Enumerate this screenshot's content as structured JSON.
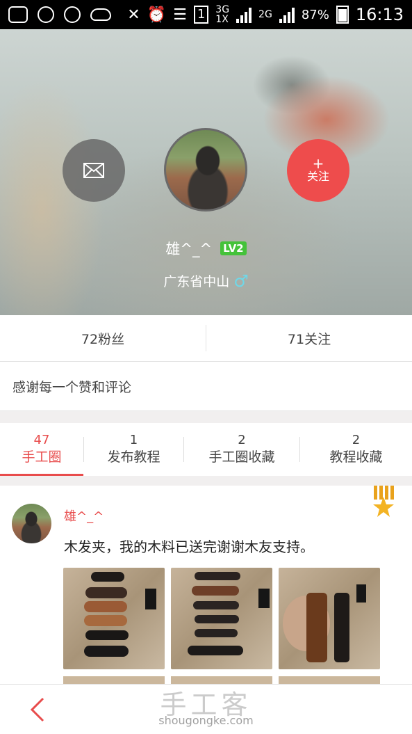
{
  "status_bar": {
    "lte_top": "3G",
    "lte_bottom": "1X",
    "network": "2G",
    "sim": "1",
    "battery": "87%",
    "time": "16:13"
  },
  "profile": {
    "username": "雄^_^",
    "level": "LV2",
    "location": "广东省中山",
    "gender_symbol": "♂",
    "follow_plus": "+",
    "follow_label": "关注",
    "followers": "72粉丝",
    "following": "71关注",
    "bio": "感谢每一个赞和评论"
  },
  "tabs": [
    {
      "count": "47",
      "label": "手工圈"
    },
    {
      "count": "1",
      "label": "发布教程"
    },
    {
      "count": "2",
      "label": "手工圈收藏"
    },
    {
      "count": "2",
      "label": "教程收藏"
    }
  ],
  "post": {
    "username": "雄^_^",
    "text": "木发夹，我的木料已送完谢谢木友支持。"
  },
  "watermark": {
    "title": "手工客",
    "url": "shougongke.com"
  },
  "colors": {
    "accent": "#e84c4c",
    "level_badge": "#44c23a",
    "gender": "#6fd8e8"
  }
}
